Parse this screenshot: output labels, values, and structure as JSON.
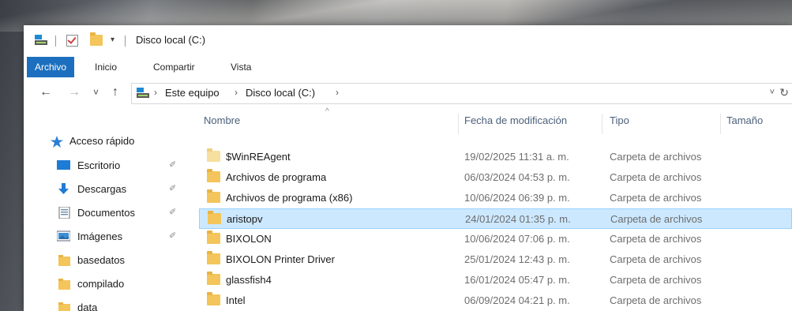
{
  "window": {
    "title": "Disco local (C:)"
  },
  "quick_access_toolbar": {
    "dropdown_glyph": "▾"
  },
  "ribbon": {
    "tabs": [
      "Archivo",
      "Inicio",
      "Compartir",
      "Vista"
    ]
  },
  "navigation": {
    "back_glyph": "←",
    "forward_glyph": "→",
    "recent_glyph": "˅",
    "up_glyph": "↑"
  },
  "address_bar": {
    "breadcrumbs": [
      "Este equipo",
      "Disco local (C:)"
    ],
    "separator": "›",
    "dropdown_glyph": "˅",
    "refresh_glyph": "↻"
  },
  "nav_pane": {
    "quick_access_label": "Acceso rápido",
    "items": [
      {
        "label": "Escritorio",
        "icon": "desktop-icon",
        "pinned": true
      },
      {
        "label": "Descargas",
        "icon": "download-icon",
        "pinned": true
      },
      {
        "label": "Documentos",
        "icon": "documents-icon",
        "pinned": true
      },
      {
        "label": "Imágenes",
        "icon": "pictures-icon",
        "pinned": true
      },
      {
        "label": "basedatos",
        "icon": "folder-icon",
        "pinned": false
      },
      {
        "label": "compilado",
        "icon": "folder-icon",
        "pinned": false
      },
      {
        "label": "data",
        "icon": "folder-icon",
        "pinned": false
      }
    ],
    "pin_glyph": "✐"
  },
  "file_list": {
    "columns": [
      "Nombre",
      "Fecha de modificación",
      "Tipo",
      "Tamaño"
    ],
    "sort_glyph": "^",
    "rows": [
      {
        "name": "$WinREAgent",
        "date": "19/02/2025 11:31 a. m.",
        "type": "Carpeta de archivos",
        "selected": false
      },
      {
        "name": "Archivos de programa",
        "date": "06/03/2024 04:53 p. m.",
        "type": "Carpeta de archivos",
        "selected": false
      },
      {
        "name": "Archivos de programa (x86)",
        "date": "10/06/2024 06:39 p. m.",
        "type": "Carpeta de archivos",
        "selected": false
      },
      {
        "name": "aristopv",
        "date": "24/01/2024 01:35 p. m.",
        "type": "Carpeta de archivos",
        "selected": true
      },
      {
        "name": "BIXOLON",
        "date": "10/06/2024 07:06 p. m.",
        "type": "Carpeta de archivos",
        "selected": false
      },
      {
        "name": "BIXOLON Printer Driver",
        "date": "25/01/2024 12:43 p. m.",
        "type": "Carpeta de archivos",
        "selected": false
      },
      {
        "name": "glassfish4",
        "date": "16/01/2024 05:47 p. m.",
        "type": "Carpeta de archivos",
        "selected": false
      },
      {
        "name": "Intel",
        "date": "06/09/2024 04:21 p. m.",
        "type": "Carpeta de archivos",
        "selected": false
      }
    ]
  },
  "colors": {
    "accent": "#1c6fbf",
    "selection_bg": "#cce8ff",
    "selection_border": "#99d1ff",
    "folder": "#f3c55a"
  }
}
